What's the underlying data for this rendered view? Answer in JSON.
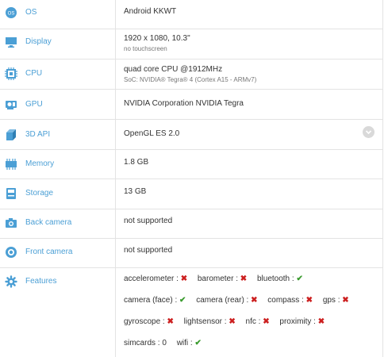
{
  "rows": [
    {
      "label": "OS",
      "icon": "os-icon",
      "value": "Android KKWT",
      "sub": ""
    },
    {
      "label": "Display",
      "icon": "display-icon",
      "value": "1920 x 1080, 10.3\"",
      "sub": "no touchscreen"
    },
    {
      "label": "CPU",
      "icon": "cpu-icon",
      "value": "quad core CPU @1912MHz",
      "sub": "SoC: NVIDIA® Tegra® 4 (Cortex A15 - ARMv7)"
    },
    {
      "label": "GPU",
      "icon": "gpu-icon",
      "value": "NVIDIA Corporation NVIDIA Tegra",
      "sub": ""
    },
    {
      "label": "3D API",
      "icon": "3d-api-icon",
      "value": "OpenGL ES 2.0",
      "sub": ""
    },
    {
      "label": "Memory",
      "icon": "memory-icon",
      "value": "1.8 GB",
      "sub": ""
    },
    {
      "label": "Storage",
      "icon": "storage-icon",
      "value": "13 GB",
      "sub": ""
    },
    {
      "label": "Back camera",
      "icon": "back-camera-icon",
      "value": "not supported",
      "sub": ""
    },
    {
      "label": "Front camera",
      "icon": "front-camera-icon",
      "value": "not supported",
      "sub": ""
    },
    {
      "label": "Features",
      "icon": "features-icon",
      "value": "",
      "sub": ""
    }
  ],
  "features": [
    [
      {
        "name": "accelerometer :",
        "mark": "✖"
      },
      {
        "name": "barometer :",
        "mark": "✖"
      },
      {
        "name": "bluetooth :",
        "mark": "✔"
      }
    ],
    [
      {
        "name": "camera (face) :",
        "mark": "✔"
      },
      {
        "name": "camera (rear) :",
        "mark": "✖"
      },
      {
        "name": "compass :",
        "mark": "✖"
      },
      {
        "name": "gps :",
        "mark": "✖"
      }
    ],
    [
      {
        "name": "gyroscope :",
        "mark": "✖"
      },
      {
        "name": "lightsensor :",
        "mark": "✖"
      },
      {
        "name": "nfc :",
        "mark": "✖"
      },
      {
        "name": "proximity :",
        "mark": "✖"
      }
    ],
    [
      {
        "name": "simcards : 0",
        "mark": ""
      },
      {
        "name": "wifi :",
        "mark": "✔"
      }
    ]
  ],
  "colors": {
    "label": "#4b9fd5",
    "icon": "#4b9fd5",
    "no": "#cc1f1f",
    "yes": "#3a9b2e",
    "border": "#e3e3e3"
  }
}
